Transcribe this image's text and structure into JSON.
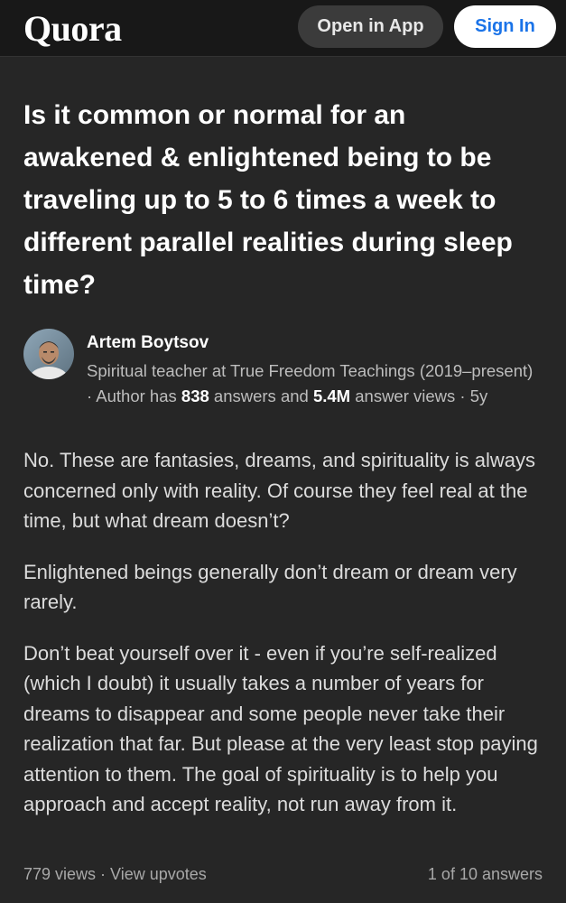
{
  "header": {
    "logo": "Quora",
    "open_in_app": "Open in App",
    "sign_in": "Sign In"
  },
  "question": {
    "title": "Is it common or normal for an awakened & enlightened being to be traveling up to 5 to 6 times a week to different parallel realities during sleep time?"
  },
  "author": {
    "name": "Artem Boytsov",
    "credential_prefix": "Spiritual teacher at True Freedom Teachings (2019–present) · Author has ",
    "answers_count": "838",
    "credential_mid": " answers and ",
    "views_count": "5.4M",
    "credential_suffix": " answer views · 5y",
    "avatar_icon": "user-avatar-photo"
  },
  "answer": {
    "paragraphs": [
      "No. These are fantasies, dreams, and spirituality is always concerned only with reality. Of course they feel real at the time, but what dream doesn’t?",
      "Enlightened beings generally don’t dream or dream very rarely.",
      "Don’t beat yourself over it - even if you’re self-realized (which I doubt) it usually takes a number of years for dreams to disappear and some people never take their realization that far. But please at the very least stop paying attention to them. The goal of spirituality is to help you approach and accept reality, not run away from it."
    ]
  },
  "footer": {
    "views": "779 views",
    "separator": " · ",
    "view_upvotes": "View upvotes",
    "position": "1 of 10 answers"
  },
  "colors": {
    "background": "#262626",
    "header": "#181818",
    "accent_link": "#1a73e8"
  }
}
